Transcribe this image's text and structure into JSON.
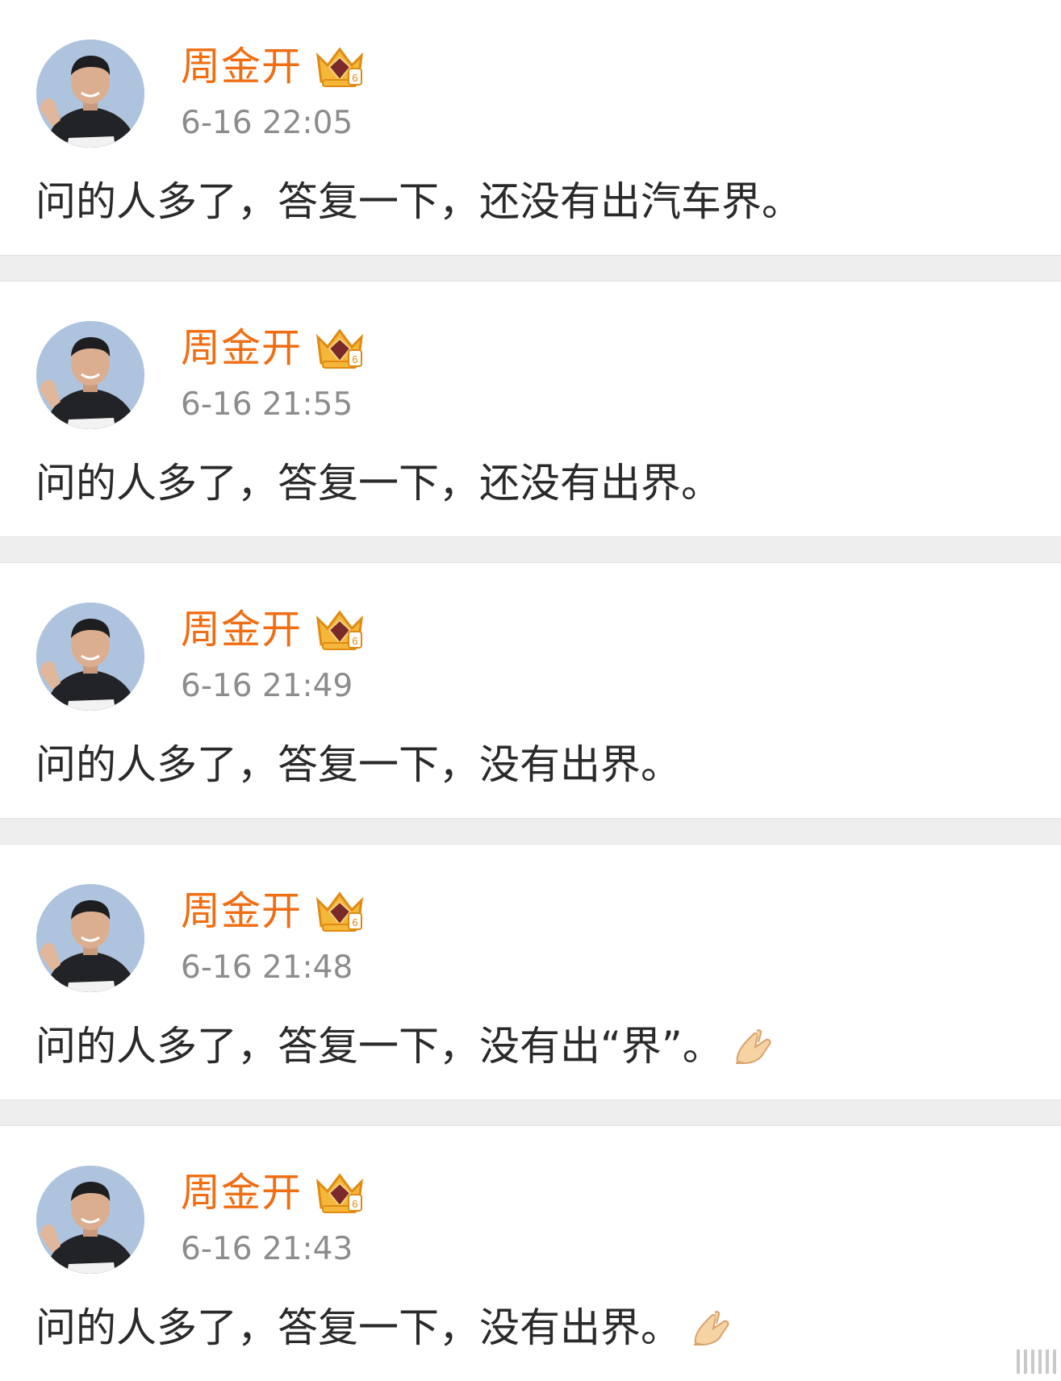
{
  "colors": {
    "author_name": "#f06d12",
    "timestamp": "#8c8c8c",
    "body_text": "#2a2a2a",
    "divider": "#eeeeee",
    "background": "#ffffff"
  },
  "icons": {
    "avatar": "avatar-photo",
    "badge": "crown-badge-icon",
    "emoji": "pray-hands-emoji-icon",
    "scroll": "scroll-handle"
  },
  "posts": [
    {
      "author": "周金开",
      "time": "6-16 22:05",
      "text": "问的人多了，答复一下，还没有出汽车界。",
      "has_emoji": false
    },
    {
      "author": "周金开",
      "time": "6-16 21:55",
      "text": "问的人多了，答复一下，还没有出界。",
      "has_emoji": false
    },
    {
      "author": "周金开",
      "time": "6-16 21:49",
      "text": "问的人多了，答复一下，没有出界。",
      "has_emoji": false
    },
    {
      "author": "周金开",
      "time": "6-16 21:48",
      "text": "问的人多了，答复一下，没有出“界”。",
      "has_emoji": true
    },
    {
      "author": "周金开",
      "time": "6-16 21:43",
      "text": "问的人多了，答复一下，没有出界。",
      "has_emoji": true
    }
  ]
}
